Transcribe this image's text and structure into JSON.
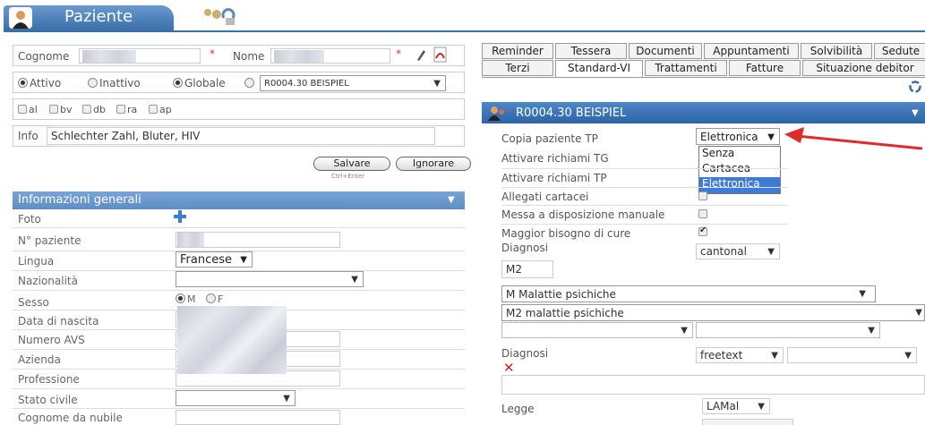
{
  "header": {
    "title": "Paziente"
  },
  "patient_form": {
    "cognome_label": "Cognome",
    "nome_label": "Nome",
    "required_mark": "*",
    "status": {
      "attivo": "Attivo",
      "inattivo": "Inattivo",
      "globale": "Globale",
      "patient_select": "R0004.30 BEISPIEL"
    },
    "flags": [
      "al",
      "bv",
      "db",
      "ra",
      "ap"
    ],
    "info_label": "Info",
    "info_value": "Schlechter Zahl, Bluter, HIV",
    "save_label": "Salvare",
    "save_hint": "Ctrl+Enter",
    "ignore_label": "Ignorare"
  },
  "general_info": {
    "title": "Informazioni generali",
    "fields": {
      "foto": "Foto",
      "numero_paziente": "N° paziente",
      "lingua": "Lingua",
      "lingua_value": "Francese",
      "nazionalita": "Nazionalità",
      "sesso": "Sesso",
      "sesso_m": "M",
      "sesso_f": "F",
      "data_nascita": "Data di nascita",
      "numero_avs": "Numero AVS",
      "azienda": "Azienda",
      "professione": "Professione",
      "stato_civile": "Stato civile",
      "cognome_nubile": "Cognome da nubile"
    }
  },
  "tabs_row1": [
    "Reminder",
    "Tessera",
    "Documenti",
    "Appuntamenti",
    "Solvibilità",
    "Sedute"
  ],
  "tabs_row2": [
    "Terzi",
    "Standard-VI",
    "Trattamenti",
    "Fatture",
    "Situazione debitor"
  ],
  "right_panel": {
    "title": "R0004.30 BEISPIEL",
    "copia_label": "Copia paziente TP",
    "copia_value": "Elettronica",
    "dropdown_options": [
      "Senza",
      "Cartacea",
      "Elettronica"
    ],
    "tg_label": "Attivare richiami TG",
    "tp_label": "Attivare richiami TP",
    "allegati_label": "Allegati cartacei",
    "messa_label": "Messa a disposizione manuale",
    "maggior_label": "Maggior bisogno di cure",
    "diagnosi_label": "Diagnosi",
    "diagnosi_type": "cantonal",
    "diagnosi_code": "M2",
    "diagnosi_sel1": "M Malattie psichiche",
    "diagnosi_sel2": "M2 malattie psichiche",
    "diagnosi2_label": "Diagnosi",
    "diagnosi2_type": "freetext",
    "legge_label": "Legge",
    "legge_value": "LAMal"
  },
  "colors": {
    "accent": "#3a6fa8",
    "section_bar": "#5d8ec5",
    "arrow": "#e02b2b"
  }
}
